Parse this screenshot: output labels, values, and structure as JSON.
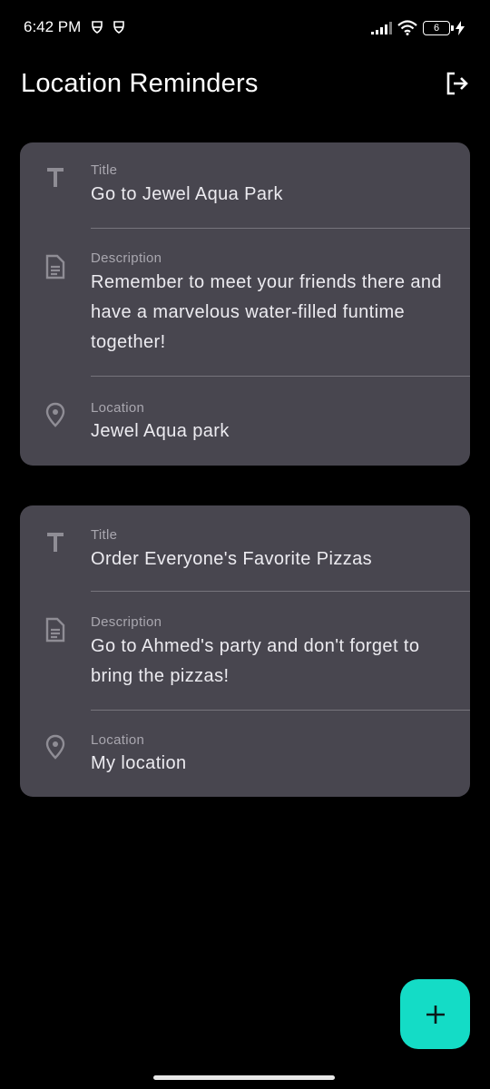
{
  "status_bar": {
    "time": "6:42 PM",
    "battery_level": "6"
  },
  "app_bar": {
    "title": "Location Reminders"
  },
  "reminders": [
    {
      "title_label": "Title",
      "title": "Go to Jewel Aqua Park",
      "description_label": "Description",
      "description": "Remember to meet your friends there and have a marvelous water-filled funtime together!",
      "location_label": "Location",
      "location": "Jewel Aqua park"
    },
    {
      "title_label": "Title",
      "title": "Order Everyone's Favorite Pizzas",
      "description_label": "Description",
      "description": "Go to Ahmed's party and don't forget to bring the pizzas!",
      "location_label": "Location",
      "location": "My location"
    }
  ],
  "fab": {
    "icon": "plus-icon",
    "color": "#14dcc6"
  },
  "colors": {
    "background": "#000000",
    "card": "#48464f",
    "accent": "#14dcc6"
  }
}
